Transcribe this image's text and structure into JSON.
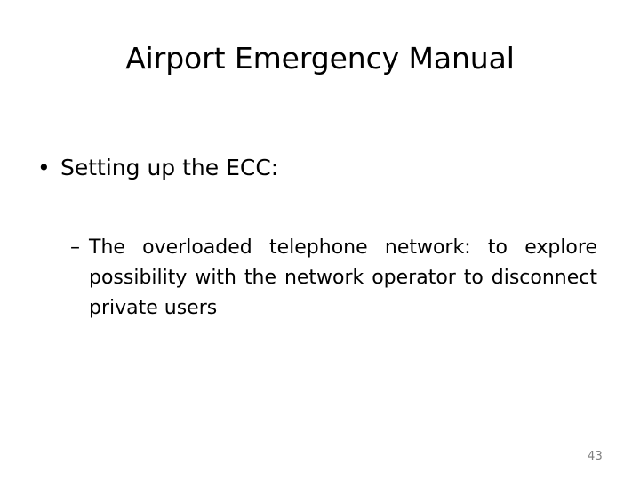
{
  "slide": {
    "title": "Airport Emergency Manual",
    "background_color": "#ffffff",
    "text_color": "#000000",
    "page_number": "43",
    "page_number_color": "#7f7f7f",
    "bullets": [
      {
        "level": 1,
        "marker": "•",
        "text": "Setting up the ECC:"
      },
      {
        "level": 2,
        "marker": "–",
        "text": "The overloaded telephone network: to explore possibility with the network operator to disconnect private users"
      }
    ]
  }
}
